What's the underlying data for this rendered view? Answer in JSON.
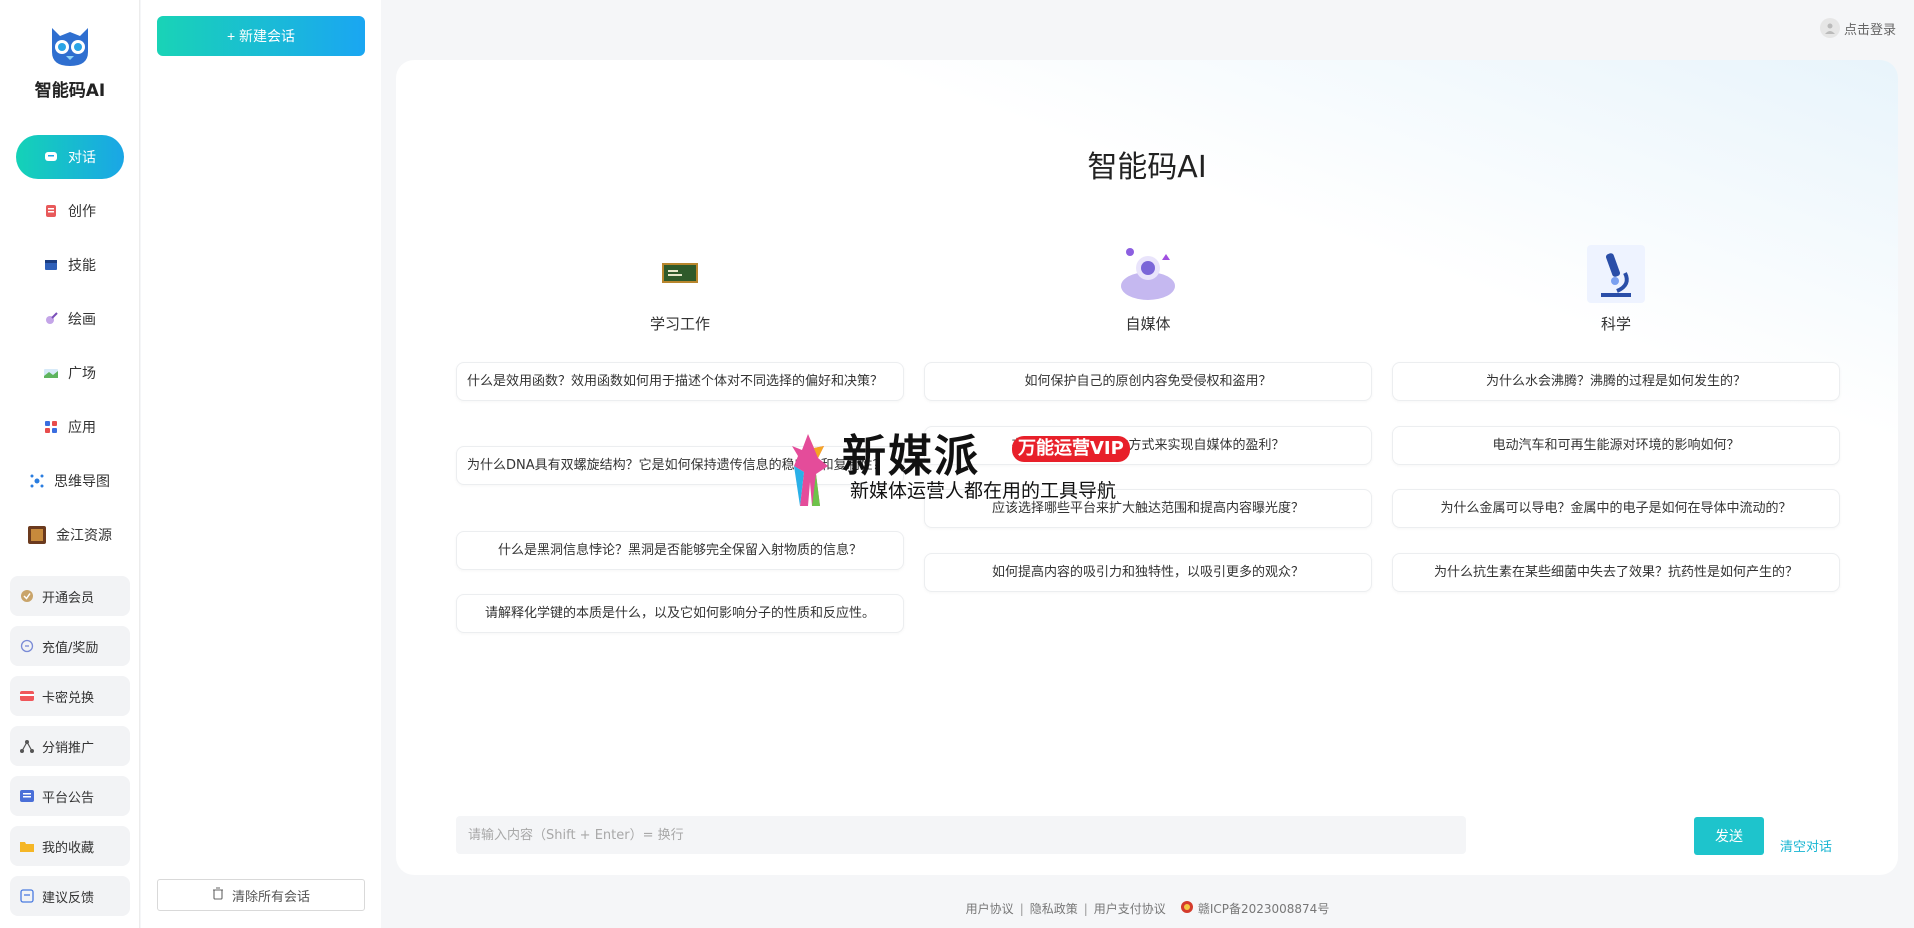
{
  "brand": {
    "name": "智能码AI"
  },
  "nav": {
    "items": [
      {
        "label": "对话",
        "icon": "chat-icon"
      },
      {
        "label": "创作",
        "icon": "notebook-icon"
      },
      {
        "label": "技能",
        "icon": "window-icon"
      },
      {
        "label": "绘画",
        "icon": "brush-icon"
      },
      {
        "label": "广场",
        "icon": "landscape-icon"
      },
      {
        "label": "应用",
        "icon": "apps-icon"
      },
      {
        "label": "思维导图",
        "icon": "mindmap-icon"
      },
      {
        "label": "金江资源",
        "icon": "resource-icon"
      }
    ],
    "buttons": [
      {
        "label": "开通会员",
        "icon": "vip-icon"
      },
      {
        "label": "充值/奖励",
        "icon": "recharge-icon"
      },
      {
        "label": "卡密兑换",
        "icon": "card-icon"
      },
      {
        "label": "分销推广",
        "icon": "share-icon"
      },
      {
        "label": "平台公告",
        "icon": "notice-icon"
      },
      {
        "label": "我的收藏",
        "icon": "folder-icon"
      },
      {
        "label": "建议反馈",
        "icon": "feedback-icon"
      }
    ]
  },
  "sessions": {
    "new_label": "+ 新建会话",
    "clear_label": "清除所有会话"
  },
  "header": {
    "login_label": "点击登录"
  },
  "main": {
    "title": "智能码AI",
    "columns": [
      {
        "title": "学习工作",
        "questions": [
          "什么是效用函数？效用函数如何用于描述个体对不同选择的偏好和决策？",
          "为什么DNA具有双螺旋结构？它是如何保持遗传信息的稳定性和复制性？",
          "什么是黑洞信息悖论？黑洞是否能够完全保留入射物质的信息？",
          "请解释化学键的本质是什么，以及它如何影响分子的性质和反应性。"
        ]
      },
      {
        "title": "自媒体",
        "questions": [
          "如何保护自己的原创内容免受侵权和盗用？",
          "有哪些推广和可行的方式来实现自媒体的盈利？",
          "应该选择哪些平台来扩大触达范围和提高内容曝光度？",
          "如何提高内容的吸引力和独特性，以吸引更多的观众？"
        ]
      },
      {
        "title": "科学",
        "questions": [
          "为什么水会沸腾？沸腾的过程是如何发生的？",
          "电动汽车和可再生能源对环境的影响如何？",
          "为什么金属可以导电？金属中的电子是如何在导体中流动的？",
          "为什么抗生素在某些细菌中失去了效果？抗药性是如何产生的？"
        ]
      }
    ],
    "input_placeholder": "请输入内容（Shift + Enter）= 换行",
    "send_label": "发送",
    "clear_label": "清空对话"
  },
  "footer": {
    "user_agreement": "用户协议",
    "privacy": "隐私政策",
    "payment": "用户支付协议",
    "icp": "赣ICP备2023008874号"
  },
  "watermark": {
    "title": "新媒派",
    "badge": "万能运营VIP",
    "subtitle": "新媒体运营人都在用的工具导航"
  },
  "colors": {
    "accent_start": "#14d2b7",
    "accent_end": "#1aa6e6",
    "send": "#1ec4cc",
    "watermark_badge": "#e8202a"
  }
}
